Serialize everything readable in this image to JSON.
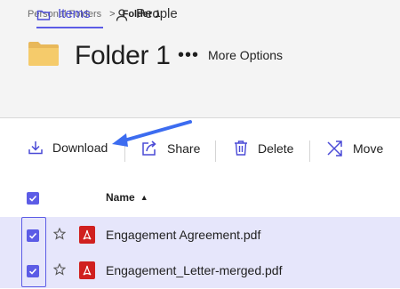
{
  "breadcrumb": {
    "parent": "Personal Folders",
    "separator": ">",
    "current": "Folder 1"
  },
  "header": {
    "title": "Folder 1",
    "more_label": "More Options"
  },
  "tabs": [
    {
      "label": "Items",
      "active": true
    },
    {
      "label": "People",
      "active": false
    }
  ],
  "toolbar": {
    "download": "Download",
    "share": "Share",
    "delete": "Delete",
    "move": "Move"
  },
  "table": {
    "name_header": "Name",
    "sort": "ascending",
    "rows": [
      {
        "name": "Engagement Agreement.pdf",
        "selected": true,
        "starred": false,
        "type": "pdf"
      },
      {
        "name": "Engagement_Letter-merged.pdf",
        "selected": true,
        "starred": false,
        "type": "pdf"
      }
    ]
  },
  "colors": {
    "accent": "#5c5ce6",
    "selected_row": "#e6e6fb",
    "pdf": "#d0201f",
    "header_bg": "#f4f4f4"
  }
}
